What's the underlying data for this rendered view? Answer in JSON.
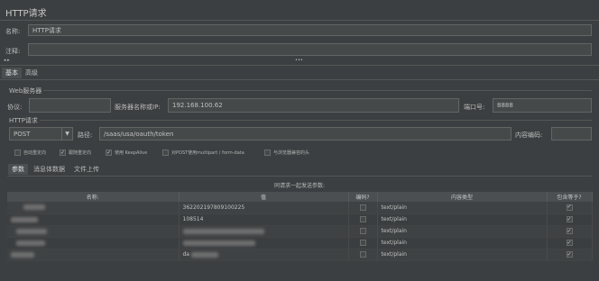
{
  "window": {
    "title": "HTTP请求"
  },
  "name_field": {
    "label": "名称:",
    "value": "HTTP请求"
  },
  "comment_field": {
    "label": "注释:",
    "value": ""
  },
  "collapse_handle": "•••",
  "top_tabs": [
    {
      "label": "基本"
    },
    {
      "label": "高级"
    }
  ],
  "web_server": {
    "legend": "Web服务器",
    "protocol_label": "协议:",
    "protocol_value": "",
    "host_label": "服务器名称或IP:",
    "host_value": "192.168.100.62",
    "port_label": "端口号:",
    "port_value": "8888"
  },
  "http_request": {
    "legend": "HTTP请求",
    "method": "POST",
    "path_label": "路径:",
    "path_value": "/saas/usa/oauth/token",
    "encoding_label": "内容编码:",
    "encoding_value": ""
  },
  "options": [
    {
      "label": "自动重定向",
      "checked": false
    },
    {
      "label": "跟随重定向",
      "checked": true
    },
    {
      "label": "使用 KeepAlive",
      "checked": true
    },
    {
      "label": "对POST使用multipart / form-data",
      "checked": false
    },
    {
      "label": "与浏览器兼容的头",
      "checked": false
    }
  ],
  "sub_tabs": [
    {
      "label": "参数"
    },
    {
      "label": "消息体数据"
    },
    {
      "label": "文件上传"
    }
  ],
  "params_table": {
    "caption": "同请求一起发送参数:",
    "headers": [
      "名称:",
      "值",
      "编码?",
      "内容类型",
      "包含等于?"
    ],
    "rows": [
      {
        "value": "362202197809100225",
        "content_type": "text/plain",
        "encode": false,
        "include_equals": true
      },
      {
        "value": "108514",
        "content_type": "text/plain",
        "encode": false,
        "include_equals": true
      },
      {
        "value": "",
        "content_type": "text/plain",
        "encode": false,
        "include_equals": true
      },
      {
        "value": "",
        "content_type": "text/plain",
        "encode": false,
        "include_equals": true
      },
      {
        "value": "da",
        "content_type": "text/plain",
        "encode": false,
        "include_equals": true
      }
    ]
  }
}
